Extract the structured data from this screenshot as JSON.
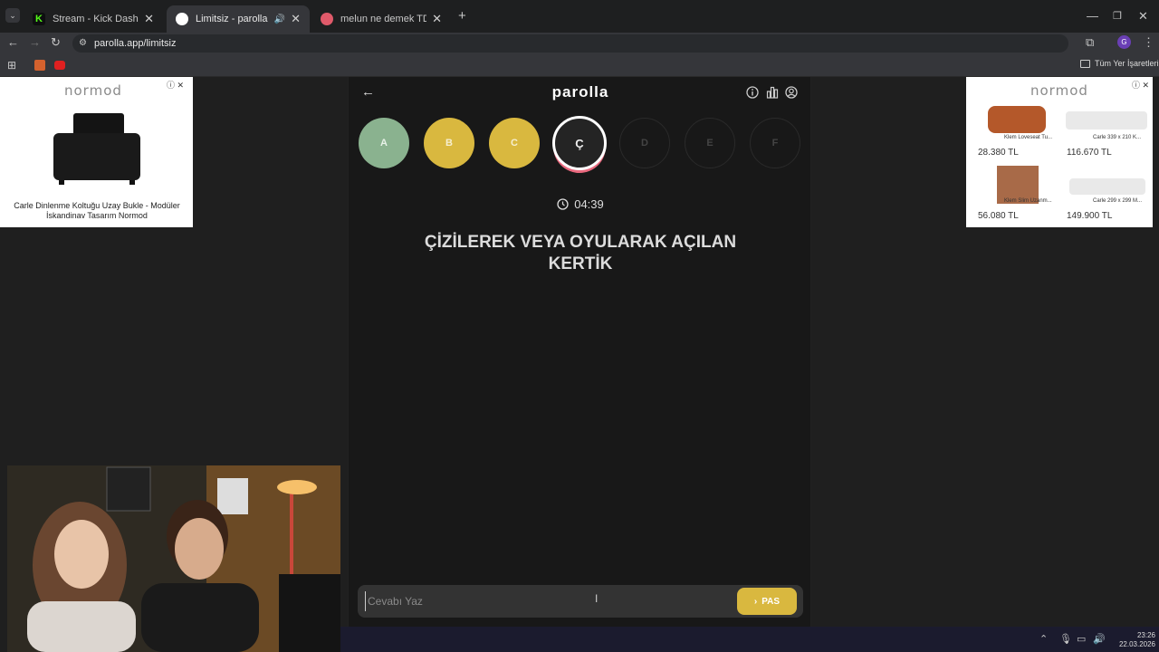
{
  "browser": {
    "tabs": [
      {
        "title": "Stream - Kick Dashboard",
        "fav_color": "#53fc18"
      },
      {
        "title": "Limitsiz - parolla - Kelime o",
        "fav_color": "#ffffff"
      },
      {
        "title": "melun ne demek TDK Sözlük A",
        "fav_color": "#e05a6a"
      }
    ],
    "url": "parolla.app/limitsiz",
    "bookmarks_label": "Tüm Yer İşaretleri",
    "profile_initial": "G"
  },
  "ads": {
    "brand": "normod",
    "left": {
      "caption": "Carle Dinlenme Koltuğu Uzay Bukle - Modüler İskandinav Tasarım Normod"
    },
    "right": {
      "items": [
        {
          "name": "Klem Loveseat Tu...",
          "price": "28.380 TL"
        },
        {
          "name": "Carle 339 x 210 K...",
          "price": "116.670 TL"
        },
        {
          "name": "Klem Slim Uzanm...",
          "price": "56.080 TL"
        },
        {
          "name": "Carle 299 x 299 M...",
          "price": "149.900 TL"
        }
      ]
    }
  },
  "game": {
    "logo": "parolla",
    "letters": [
      {
        "label": "A",
        "state": "correct"
      },
      {
        "label": "B",
        "state": "passed"
      },
      {
        "label": "C",
        "state": "passed"
      },
      {
        "label": "Ç",
        "state": "current"
      },
      {
        "label": "D",
        "state": "empty"
      },
      {
        "label": "E",
        "state": "empty"
      },
      {
        "label": "F",
        "state": "empty"
      }
    ],
    "timer": "04:39",
    "question_line1": "ÇİZİLEREK VEYA OYULARAK AÇILAN",
    "question_line2": "KERTİK",
    "input_placeholder": "Cevabı Yaz",
    "pass_label": "PAS"
  },
  "taskbar": {
    "time": "23:26",
    "date": "22.03.2026"
  },
  "colors": {
    "correct": "#8ab28f",
    "passed": "#d9b83f",
    "current_ring": "#e9697e"
  }
}
